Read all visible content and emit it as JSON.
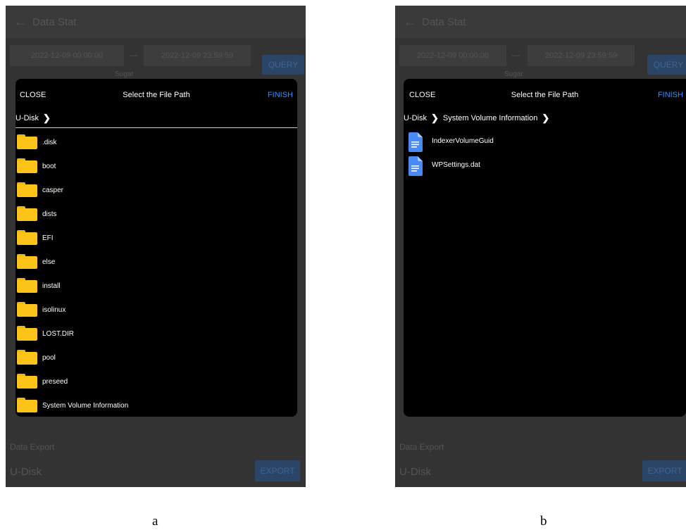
{
  "background": {
    "app_title": "Data Stat",
    "start_date": "2022-12-09 00:00:00",
    "end_date": "2022-12-09 23:59:59",
    "date_separator": "—",
    "query_label": "QUERY",
    "select_value": "Sugar",
    "export_section_label": "Data Export",
    "export_target": "U-Disk",
    "export_label": "EXPORT"
  },
  "dialog_a": {
    "close_label": "CLOSE",
    "title": "Select the File Path",
    "finish_label": "FINISH",
    "breadcrumb": [
      "U-Disk"
    ],
    "items": [
      ".disk",
      "boot",
      "casper",
      "dists",
      "EFI",
      "else",
      "install",
      "isolinux",
      "LOST.DIR",
      "pool",
      "preseed",
      "System Volume Information"
    ]
  },
  "dialog_b": {
    "close_label": "CLOSE",
    "title": "Select the File Path",
    "finish_label": "FINISH",
    "breadcrumb": [
      "U-Disk",
      "System Volume Information"
    ],
    "items": [
      "IndexerVolumeGuid",
      "WPSettings.dat"
    ]
  },
  "captions": {
    "a": "a",
    "b": "b"
  },
  "colors": {
    "accent": "#2f8fff",
    "folder": "#fcc419",
    "file": "#4a8af4",
    "dialog_bg": "#000000",
    "screen_bg": "#333333"
  }
}
